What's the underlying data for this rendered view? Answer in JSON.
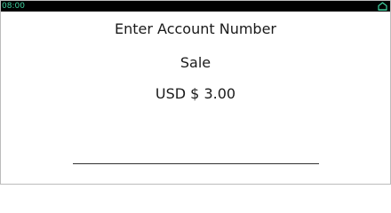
{
  "status_bar": {
    "time": "08:00",
    "accent_color": "#3fcf9e",
    "home_icon": "home-icon"
  },
  "screen": {
    "title": "Enter Account Number",
    "transaction_type": "Sale",
    "amount": "USD $ 3.00"
  },
  "account_input": {
    "value": "",
    "placeholder": ""
  }
}
